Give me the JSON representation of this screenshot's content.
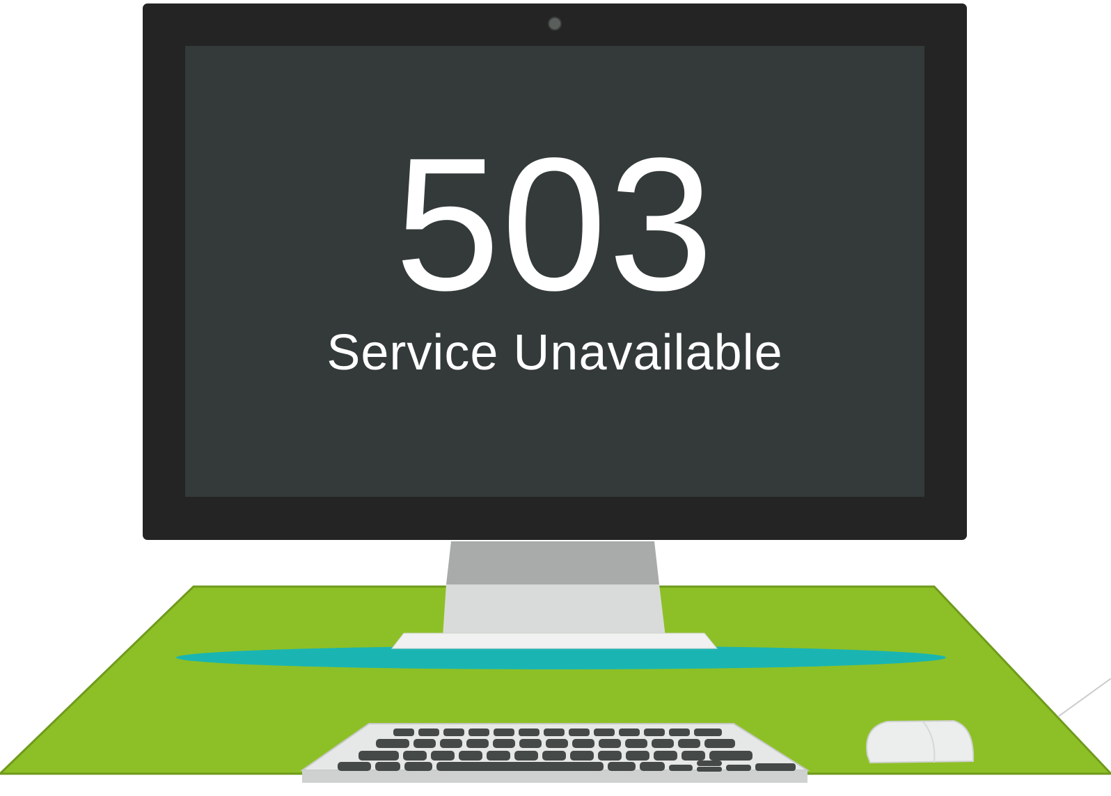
{
  "error": {
    "code": "503",
    "message": "Service Unavailable"
  },
  "colors": {
    "background": "#ffffff",
    "monitor_bezel": "#232423",
    "monitor_screen": "#343a3a",
    "webcam": "#5a5f5c",
    "stand_top": "#a9abaa",
    "stand_body": "#d9dbda",
    "stand_base": "#f0f1f0",
    "desk_mat": "#8dc026",
    "desk_mat_edge": "#6f9a1c",
    "shadow": "#1ab5b3",
    "keyboard_body": "#e6e8e7",
    "keyboard_keys": "#454948",
    "mouse": "#eceeed",
    "text": "#ffffff"
  },
  "icons": {
    "monitor": "desktop-monitor-icon",
    "keyboard": "keyboard-icon",
    "mouse": "mouse-icon"
  }
}
